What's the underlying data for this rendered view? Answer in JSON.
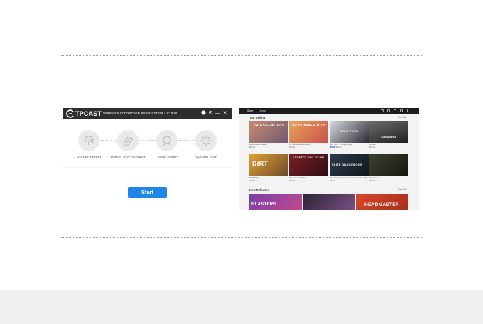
{
  "tpcast": {
    "brand": "TPCAST",
    "subtitle": "Wireless connection assistant for Oculus",
    "controls": {
      "gear": "⚙",
      "minimize": "—",
      "close": "✕"
    },
    "steps": [
      {
        "label": "Router detect",
        "icon": "router-icon"
      },
      {
        "label": "Power box connect",
        "icon": "link-icon"
      },
      {
        "label": "Cable detect",
        "icon": "cable-icon"
      },
      {
        "label": "System load",
        "icon": "loading-spinner-icon"
      }
    ],
    "start_button": "Start",
    "colors": {
      "titlebar": "#2d2e32",
      "accent": "#1e86e6"
    }
  },
  "store": {
    "nav": [
      "Store",
      "Library"
    ],
    "top_selling": {
      "title": "Top Selling",
      "see_all": "See All ›"
    },
    "new_releases": {
      "title": "New Releases",
      "see_all": "See All ›"
    },
    "row1": [
      {
        "art": "VR ESSENTIALS",
        "title": "Robo Recall Bundle",
        "price": "$29.99"
      },
      {
        "art": "VR SUMMER HITS",
        "title": "VR Summer Hits Bundle",
        "price": "$39.99"
      },
      {
        "art": "STAR TREK",
        "title": "Star Trek™: Bridge Crew",
        "price": "$39.99"
      },
      {
        "art": "ONWARD",
        "title": "Onward",
        "price": "$24.99"
      }
    ],
    "row2": [
      {
        "art": "DiRT",
        "title": "DiRT Rally",
        "price": "$19.99"
      },
      {
        "art": "I EXPECT YOU TO DIE",
        "title": "I Expect You To Die",
        "price": "$19.99"
      },
      {
        "art": "ELITE DANGEROUS",
        "title": "Elite Dangerous: Commander Deluxe Edition",
        "price": "$29.99"
      },
      {
        "art": "",
        "title": "Obduction",
        "price": "$19.99"
      }
    ],
    "row3": [
      {
        "art": "BLASTERS"
      },
      {
        "art": ""
      },
      {
        "art": "HEADMASTER"
      }
    ],
    "sale_badge": "-40%"
  }
}
